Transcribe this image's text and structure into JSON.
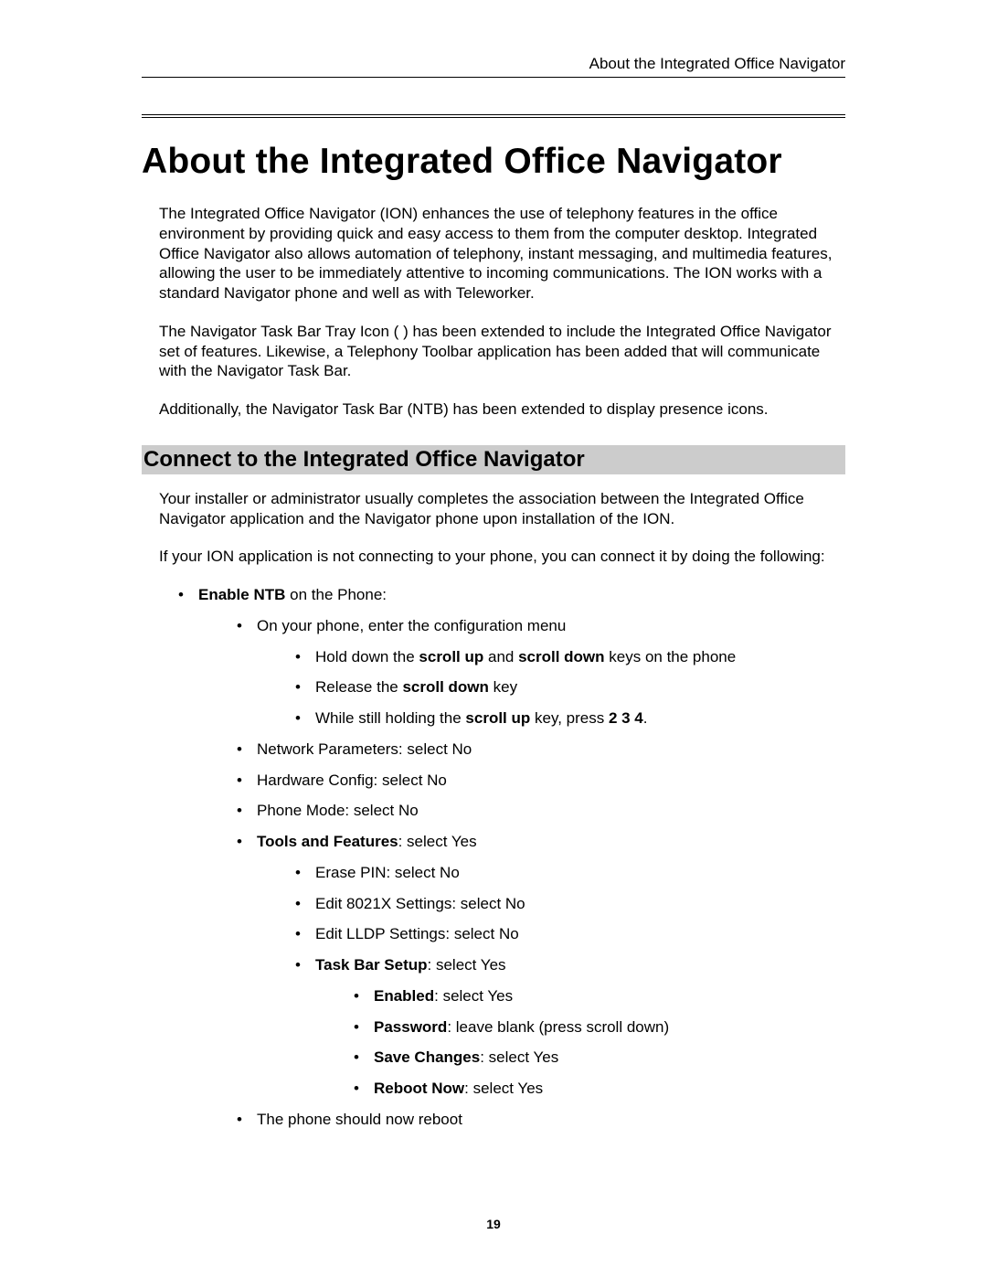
{
  "header": {
    "running_title": "About the Integrated Office Navigator"
  },
  "title": "About the Integrated Office Navigator",
  "intro_paragraphs": [
    "The Integrated Office Navigator (ION) enhances the use of telephony features in the office environment by providing quick and easy access to them from the computer desktop. Integrated Office Navigator also allows automation of telephony, instant messaging, and multimedia features, allowing the user to be immediately attentive to incoming communications.  The ION works with a standard Navigator phone and well as with Teleworker.",
    "The Navigator Task Bar Tray Icon (    ) has been extended to include the Integrated Office Navigator set of features. Likewise, a Telephony Toolbar application has been added that will communicate with the Navigator Task Bar.",
    "Additionally, the Navigator Task Bar (NTB) has been extended to display presence icons."
  ],
  "section_heading": "Connect to the Integrated Office Navigator",
  "after_heading_paragraphs": [
    "Your installer or administrator usually completes the association between the Integrated Office Navigator application and the Navigator phone upon installation of the ION.",
    "If your ION application is not connecting to your phone, you can connect it by doing the following:"
  ],
  "b": {
    "enable_ntb_bold": "Enable NTB",
    "enable_ntb_rest": " on the Phone:",
    "config_menu": "On your phone, enter the configuration menu",
    "hold_pre": "Hold down the ",
    "scroll_up": "scroll up",
    "hold_mid": " and ",
    "scroll_down": "scroll down",
    "hold_post": " keys on the phone",
    "release_pre": "Release the ",
    "release_post": " key",
    "while_pre": "While still holding the ",
    "while_mid": " key, press ",
    "two34": "2 3 4",
    "period": ".",
    "network_params": "Network Parameters: select No",
    "hardware": "Hardware Config: select No",
    "phone_mode": "Phone Mode: select No",
    "tools_bold": "Tools and Features",
    "tools_rest": ": select Yes",
    "erase_pin": "Erase PIN: select No",
    "edit_8021x": "Edit 8021X Settings: select No",
    "edit_lldp": "Edit LLDP Settings: select No",
    "tbs_bold": "Task Bar Setup",
    "tbs_rest": ": select Yes",
    "enabled_bold": "Enabled",
    "enabled_rest": ": select Yes",
    "password_bold": "Password",
    "password_rest": ": leave blank (press scroll down)",
    "save_bold": "Save Changes",
    "save_rest": ": select Yes",
    "reboot_bold": "Reboot Now",
    "reboot_rest": ": select Yes",
    "should_reboot": "The phone should now reboot"
  },
  "page_number": "19"
}
